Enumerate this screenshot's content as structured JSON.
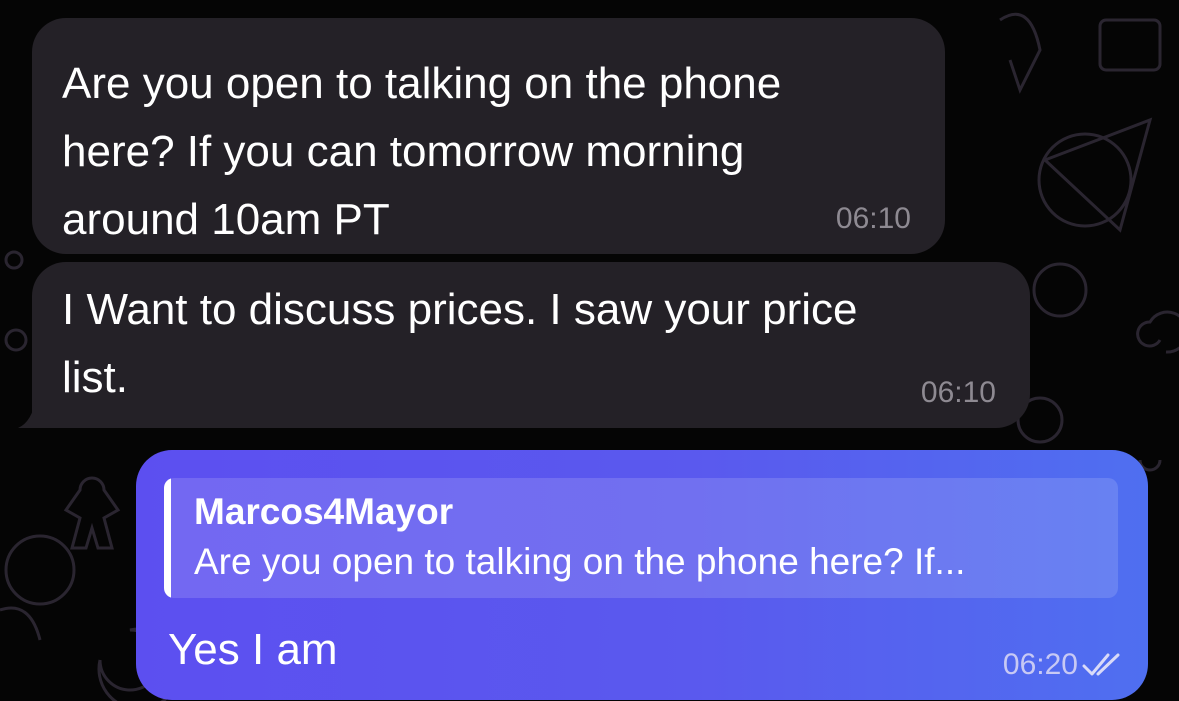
{
  "messages": [
    {
      "direction": "incoming",
      "text": "Are you open to talking on the phone\nhere? If you can tomorrow morning\naround 10am PT",
      "time": "06:10"
    },
    {
      "direction": "incoming",
      "text": "I Want to discuss prices. I saw your price\nlist.",
      "time": "06:10"
    },
    {
      "direction": "outgoing",
      "reply_to": {
        "author": "Marcos4Mayor",
        "snippet": "Are you open to talking on the phone here? If..."
      },
      "text": "Yes I am",
      "time": "06:20",
      "status_icon": "double-check-icon"
    }
  ],
  "colors": {
    "background": "#050505",
    "incoming_bubble": "#242127",
    "outgoing_bubble": "#5a59ee",
    "incoming_time": "#8e8a92",
    "outgoing_time": "#c8c9f4",
    "doodle_stroke": "#2a2530"
  }
}
